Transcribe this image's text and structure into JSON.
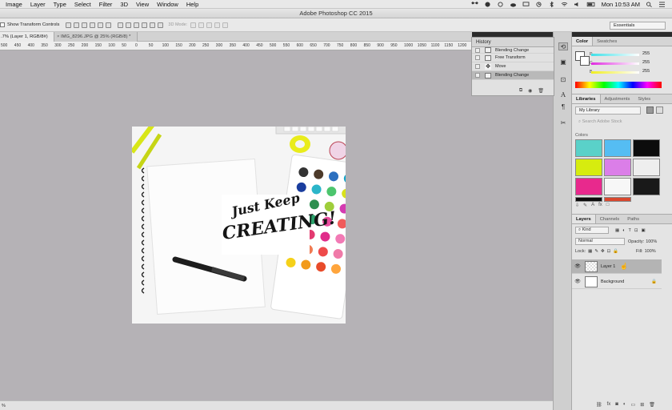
{
  "menubar": {
    "items": [
      "Image",
      "Layer",
      "Type",
      "Select",
      "Filter",
      "3D",
      "View",
      "Window",
      "Help"
    ],
    "clock": "Mon 10:53 AM"
  },
  "window": {
    "title": "Adobe Photoshop CC 2015"
  },
  "options": {
    "show_transform": "Show Transform Controls",
    "mode3d": "3D Mode:",
    "workspace": "Essentials"
  },
  "doc_tabs": [
    {
      "label": ".7% (Layer 1, RGB/8#) *",
      "close": "×"
    },
    {
      "label": "IMG_8296.JPG @ 25% (RGB/8) *",
      "close": "×"
    }
  ],
  "ruler": [
    "500",
    "450",
    "400",
    "350",
    "300",
    "250",
    "200",
    "150",
    "100",
    "50",
    "0",
    "50",
    "100",
    "150",
    "200",
    "250",
    "300",
    "350",
    "400",
    "450",
    "500",
    "550",
    "600",
    "650",
    "700",
    "750",
    "800",
    "850",
    "900",
    "950",
    "1000",
    "1050",
    "1100",
    "1150",
    "1200",
    "1250"
  ],
  "status": {
    "zoom": "%"
  },
  "history": {
    "title": "History",
    "items": [
      {
        "label": "Blending Change",
        "selected": false
      },
      {
        "label": "Free Transform",
        "selected": false
      },
      {
        "label": "Move",
        "selected": false
      },
      {
        "label": "Blending Change",
        "selected": true
      }
    ]
  },
  "color_panel": {
    "tabs": [
      "Color",
      "Swatches"
    ],
    "channels": [
      {
        "label": "R",
        "value": "255",
        "color": "#27c8d6"
      },
      {
        "label": "G",
        "value": "255",
        "color": "#d42cd0"
      },
      {
        "label": "B",
        "value": "255",
        "color": "#e6e21a"
      }
    ]
  },
  "libraries": {
    "tabs": [
      "Libraries",
      "Adjustments",
      "Styles"
    ],
    "library": "My Library",
    "search_placeholder": "Search Adobe Stock",
    "section": "Colors",
    "swatches": [
      "#5ad1c9",
      "#55bdf3",
      "#0c0c0c",
      "#d6ec0f",
      "#db7ee8",
      "#eeeeee",
      "#e8298d",
      "#f7f7f7",
      "#191919"
    ],
    "swatches_row_last": [
      "#0c0c0c",
      "#d9472e"
    ]
  },
  "layers": {
    "tabs": [
      "Layers",
      "Channels",
      "Paths"
    ],
    "kind": "Kind",
    "blend_mode": "Normal",
    "opacity_label": "Opacity:",
    "opacity": "100%",
    "lock_label": "Lock:",
    "fill_label": "Fill:",
    "fill": "100%",
    "items": [
      {
        "name": "Layer 1",
        "selected": true,
        "thumb": "transparent"
      },
      {
        "name": "Background",
        "selected": false,
        "thumb": "white"
      }
    ]
  }
}
